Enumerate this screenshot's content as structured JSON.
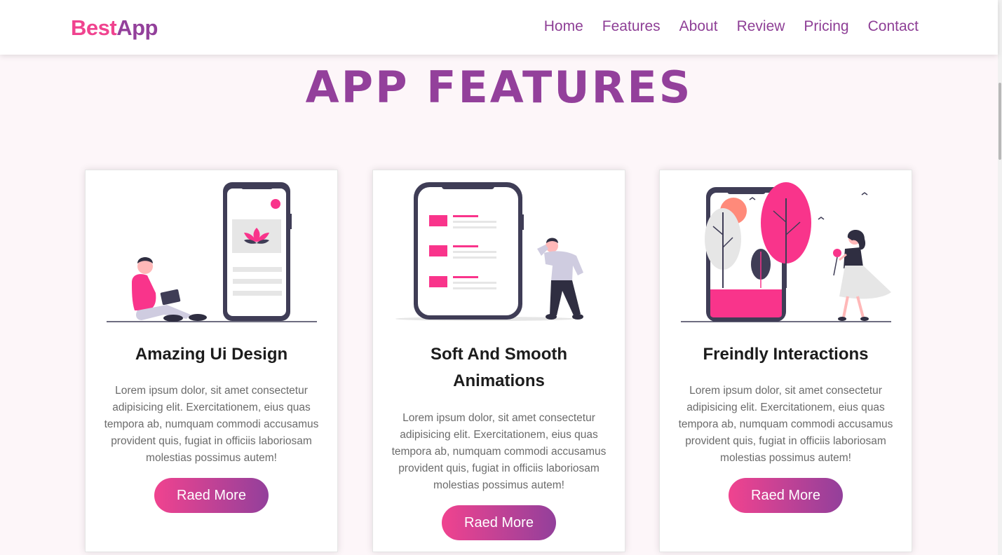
{
  "brand": {
    "part1": "Best",
    "part2": "App"
  },
  "nav": {
    "items": [
      {
        "label": "Home"
      },
      {
        "label": "Features"
      },
      {
        "label": "About"
      },
      {
        "label": "Review"
      },
      {
        "label": "Pricing"
      },
      {
        "label": "Contact"
      }
    ]
  },
  "section": {
    "title": "APP FEATURES"
  },
  "cards": [
    {
      "title": "Amazing Ui Design",
      "text": "Lorem ipsum dolor, sit amet consectetur adipisicing elit. Exercitationem, eius quas tempora ab, numquam commodi accusamus provident quis, fugiat in officiis laboriosam molestias possimus autem!",
      "button": "Raed More",
      "illustration": "woman-with-laptop-and-phone-icon"
    },
    {
      "title": "Soft And Smooth Animations",
      "text": "Lorem ipsum dolor, sit amet consectetur adipisicing elit. Exercitationem, eius quas tempora ab, numquam commodi accusamus provident quis, fugiat in officiis laboriosam molestias possimus autem!",
      "button": "Raed More",
      "illustration": "man-beside-phone-list-icon"
    },
    {
      "title": "Freindly Interactions",
      "text": "Lorem ipsum dolor, sit amet consectetur adipisicing elit. Exercitationem, eius quas tempora ab, numquam commodi accusamus provident quis, fugiat in officiis laboriosam molestias possimus autem!",
      "button": "Raed More",
      "illustration": "woman-with-flower-phone-icon"
    }
  ],
  "colors": {
    "pink": "#f0438f",
    "purple": "#93409b",
    "illustration_pink": "#f9348b",
    "illustration_dark": "#3f3d56"
  }
}
